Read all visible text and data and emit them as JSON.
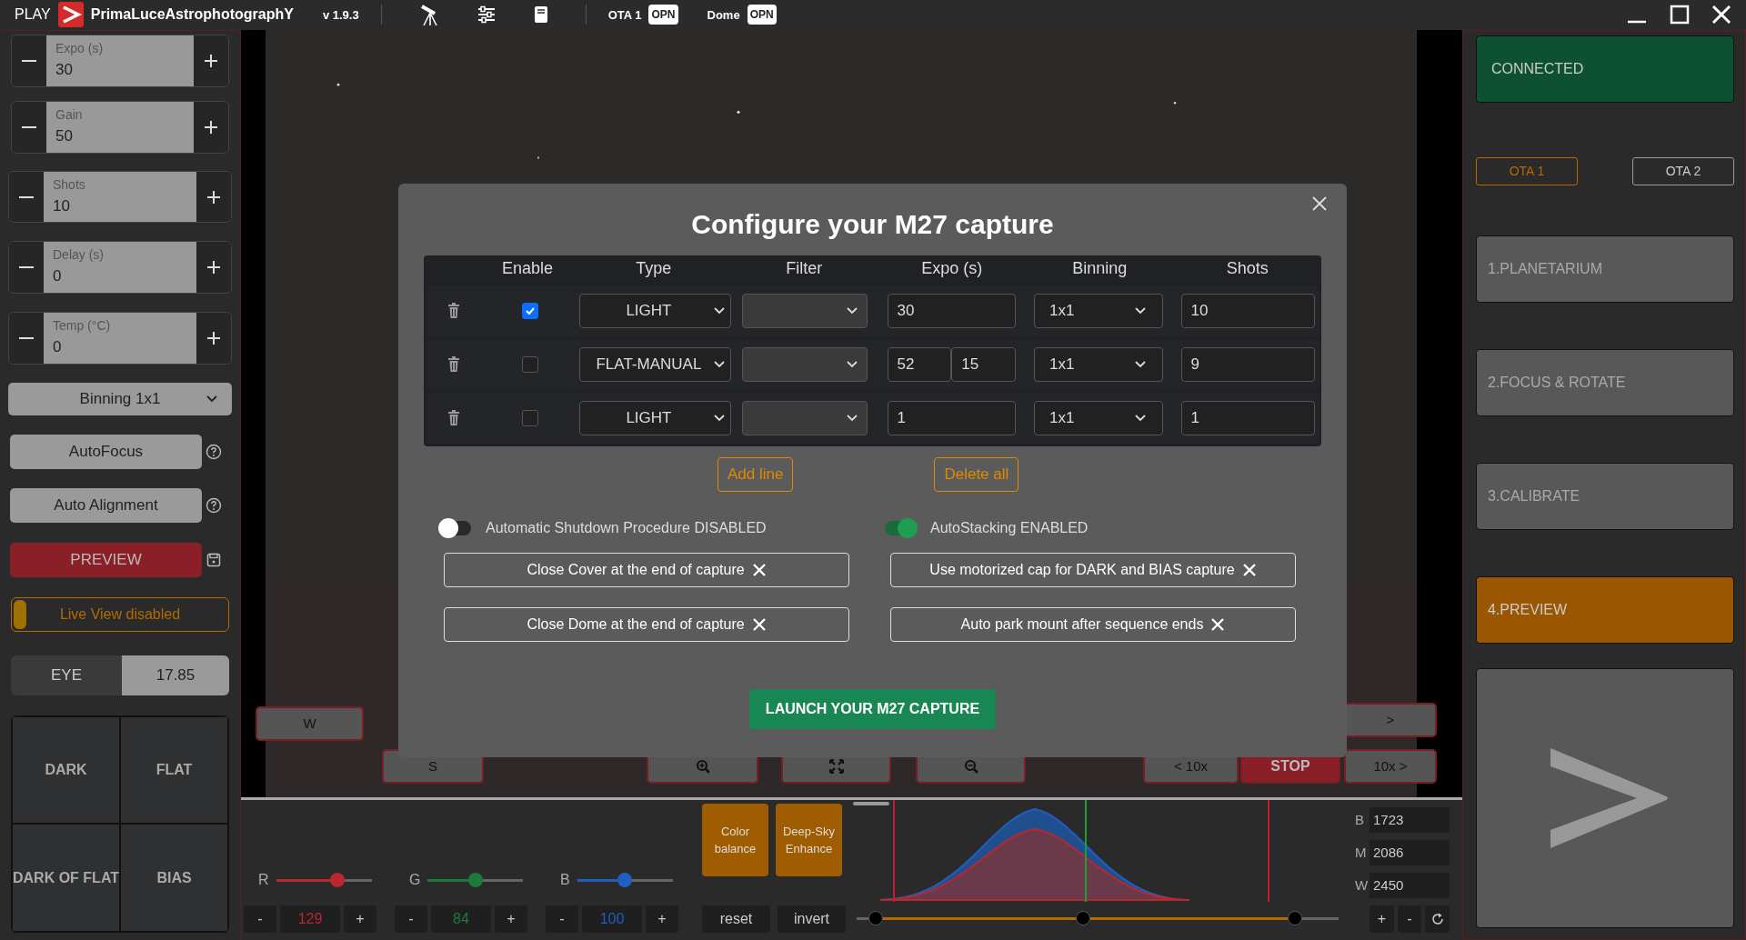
{
  "app_bar": {
    "play": "PLAY",
    "brand": "PrimaLuceAstrophotographY",
    "version": "v 1.9.3",
    "devices": [
      {
        "label": "OTA 1",
        "badge": "OPN"
      },
      {
        "label": "Dome",
        "badge": "OPN"
      }
    ]
  },
  "left_panel": {
    "steppers": [
      {
        "label": "Expo (s)",
        "value": "30"
      },
      {
        "label": "Gain",
        "value": "50"
      },
      {
        "label": "Shots",
        "value": "10"
      },
      {
        "label": "Delay (s)",
        "value": "0"
      },
      {
        "label": "Temp (°C)",
        "value": "0"
      }
    ],
    "binning": "Binning 1x1",
    "actions": [
      {
        "label": "AutoFocus"
      },
      {
        "label": "Auto Alignment"
      }
    ],
    "preview": "PREVIEW",
    "live_view": {
      "label": "Live View disabled",
      "on": false
    },
    "eye": {
      "label": "EYE",
      "value": "17.85"
    },
    "calibration": [
      "DARK",
      "FLAT",
      "DARK OF FLAT",
      "BIAS"
    ]
  },
  "viewer": {
    "controls": [
      {
        "kind": "text",
        "label": "W"
      },
      {
        "kind": "text",
        "label": ">"
      },
      {
        "kind": "text",
        "label": "S"
      },
      {
        "kind": "zoom_in"
      },
      {
        "kind": "fit"
      },
      {
        "kind": "zoom_out"
      },
      {
        "kind": "text",
        "label": "< 10x"
      },
      {
        "kind": "stop",
        "label": "STOP"
      },
      {
        "kind": "text",
        "label": "10x >"
      }
    ]
  },
  "dialog": {
    "title": "Configure your M27 capture",
    "columns": [
      "Enable",
      "Type",
      "Filter",
      "Expo (s)",
      "Binning",
      "Shots"
    ],
    "rows": [
      {
        "enabled": true,
        "type": "LIGHT",
        "expo": [
          "30"
        ],
        "binning": "1x1",
        "shots": "10"
      },
      {
        "enabled": false,
        "type": "FLAT-MANUAL",
        "expo": [
          "52",
          "15"
        ],
        "binning": "1x1",
        "shots": "9"
      },
      {
        "enabled": false,
        "type": "LIGHT",
        "expo": [
          "1"
        ],
        "binning": "1x1",
        "shots": "1"
      }
    ],
    "line_actions": [
      "Add line",
      "Delete all"
    ],
    "toggles": [
      {
        "label": "Automatic Shutdown Procedure DISABLED",
        "on": false
      },
      {
        "label": "AutoStacking ENABLED",
        "on": true
      }
    ],
    "options": [
      "Close Cover at the end of capture",
      "Use motorized cap for DARK and BIAS capture",
      "Close Dome at the end of capture",
      "Auto park mount after sequence ends"
    ],
    "launch": "LAUNCH YOUR M27 CAPTURE"
  },
  "bottom_panel": {
    "channels": [
      {
        "name": "R",
        "color": "#b8282f",
        "level": 0.64,
        "value": "129",
        "minus": "-",
        "plus": "+"
      },
      {
        "name": "G",
        "color": "#1e7a3c",
        "level": 0.5,
        "value": "84",
        "minus": "-",
        "plus": "+"
      },
      {
        "name": "B",
        "color": "#1f5fc0",
        "level": 0.5,
        "value": "100",
        "minus": "-",
        "plus": "+"
      }
    ],
    "effects": [
      "Color balance",
      "Deep-Sky Enhance"
    ],
    "reset": "reset",
    "invert": "invert",
    "levels": [
      {
        "label": "B",
        "value": "1723"
      },
      {
        "label": "M",
        "value": "2086"
      },
      {
        "label": "W",
        "value": "2450"
      }
    ],
    "level_buttons": [
      "+",
      "-"
    ],
    "stretch_handles": [
      {
        "level": 0.04
      },
      {
        "level": 0.47
      },
      {
        "level": 0.91
      }
    ]
  },
  "right_panel": {
    "status": "CONNECTED",
    "ota_tabs": [
      {
        "label": "OTA 1",
        "selected": true
      },
      {
        "label": "OTA 2",
        "selected": false
      }
    ],
    "steps": [
      {
        "label": "1.PLANETARIUM",
        "selected": false
      },
      {
        "label": "2.FOCUS & ROTATE",
        "selected": false
      },
      {
        "label": "3.CALIBRATE",
        "selected": false
      },
      {
        "label": "4.PREVIEW",
        "selected": true
      }
    ]
  }
}
